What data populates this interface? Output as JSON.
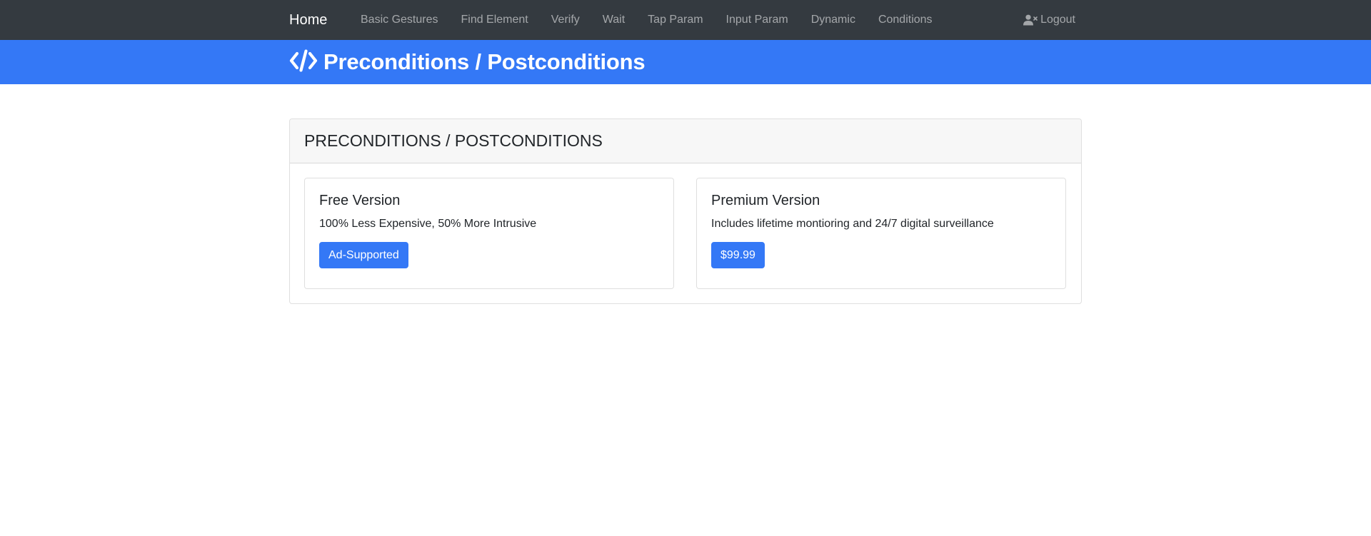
{
  "nav": {
    "brand": "Home",
    "links": [
      "Basic Gestures",
      "Find Element",
      "Verify",
      "Wait",
      "Tap Param",
      "Input Param",
      "Dynamic",
      "Conditions"
    ],
    "logout": "Logout",
    "logout_icon": "user-xmark-icon"
  },
  "hero": {
    "title": "Preconditions / Postconditions",
    "icon": "code-icon"
  },
  "card": {
    "header": "PRECONDITIONS / POSTCONDITIONS",
    "free": {
      "title": "Free Version",
      "text": "100% Less Expensive, 50% More Intrusive",
      "button": "Ad-Supported"
    },
    "premium": {
      "title": "Premium Version",
      "text": "Includes lifetime montioring and 24/7 digital surveillance",
      "button": "$99.99"
    }
  },
  "colors": {
    "navbar": "#343a40",
    "primary": "#3478f6"
  }
}
